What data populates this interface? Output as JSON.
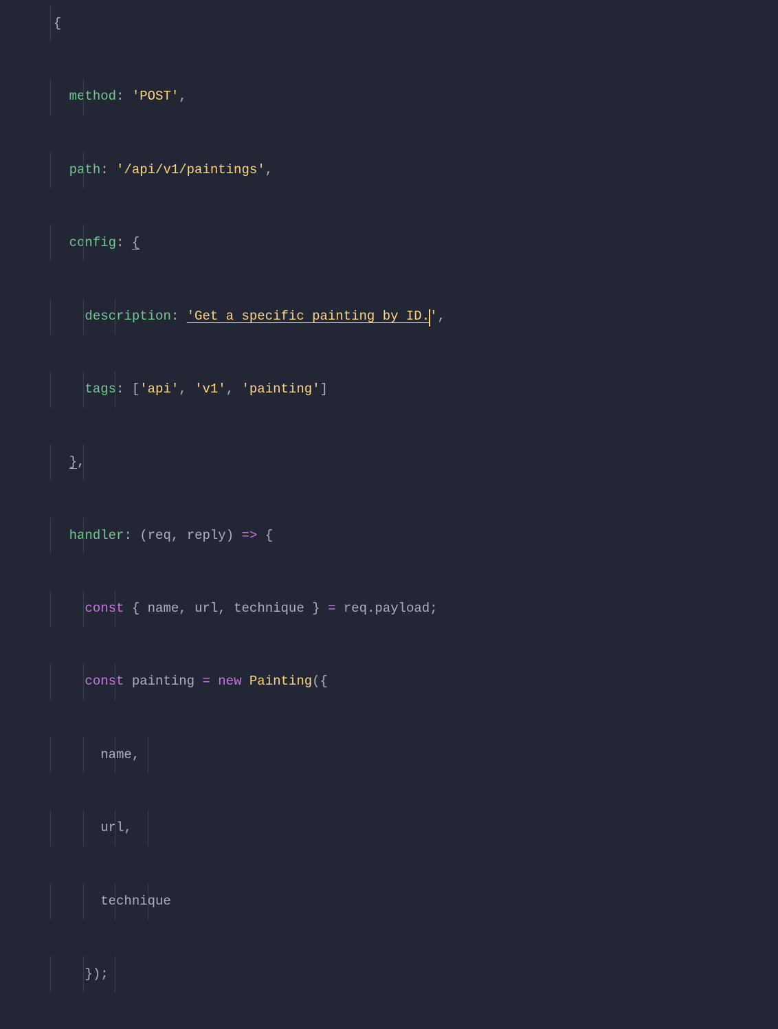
{
  "code": {
    "method_key": "method",
    "method_val": "'POST'",
    "path_key": "path",
    "path_val": "'/api/v1/paintings'",
    "config_key": "config",
    "description_key": "description",
    "description_val": "'Get a specific painting by ID.",
    "description_val_end": "'",
    "tags_key": "tags",
    "tags_val_1": "'api'",
    "tags_val_2": "'v1'",
    "tags_val_3": "'painting'",
    "handler_key": "handler",
    "handler_param1": "req",
    "handler_param2": "reply",
    "const_kw": "const",
    "destruct_1": "name",
    "destruct_2": "url",
    "destruct_3": "technique",
    "req_var": "req",
    "payload_prop": "payload",
    "painting_var": "painting",
    "new_kw": "new",
    "class_name": "Painting",
    "obj_name": "name",
    "obj_url": "url",
    "obj_tech": "technique"
  },
  "guides": {
    "g1": 18,
    "g2": 66,
    "g3": 112,
    "g4": 160
  }
}
